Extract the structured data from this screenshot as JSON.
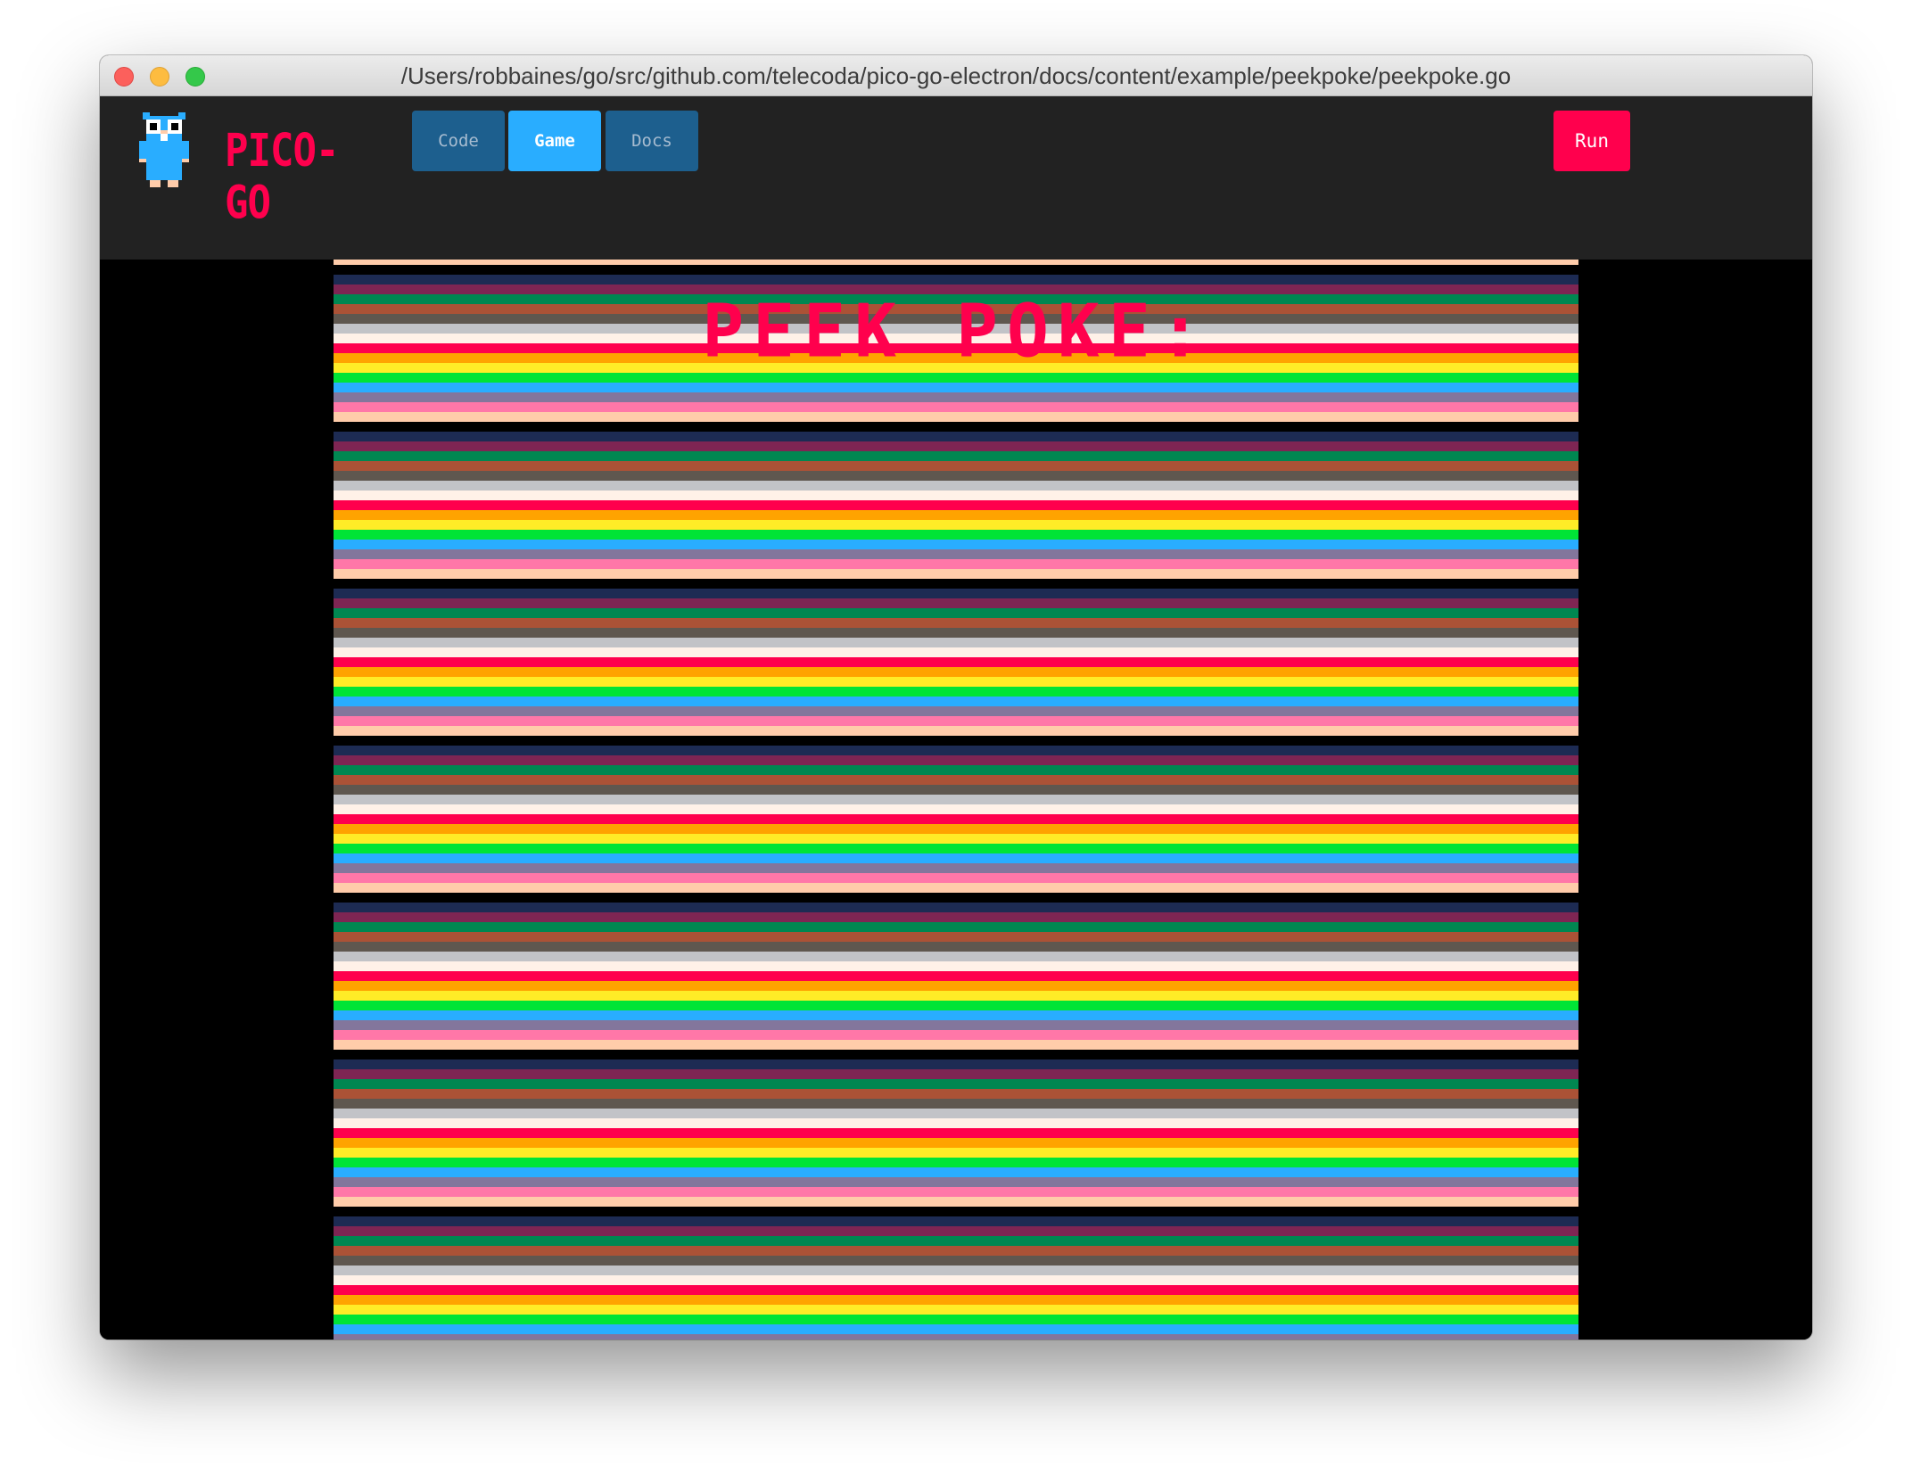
{
  "window": {
    "title": "/Users/robbaines/go/src/github.com/telecoda/pico-go-electron/docs/content/example/peekpoke/peekpoke.go"
  },
  "app": {
    "logo_text": "PICO-GO"
  },
  "tabs": [
    {
      "label": "Code",
      "active": false
    },
    {
      "label": "Game",
      "active": true
    },
    {
      "label": "Docs",
      "active": false
    }
  ],
  "run_label": "Run",
  "game": {
    "title_text": "PEEK POKE:"
  },
  "colors": {
    "accent": "#ff004d",
    "tab_active": "#29adff",
    "tab_inactive": "#1d5f8e",
    "toolbar_bg": "#222222",
    "palette": [
      "#000000",
      "#1d2b53",
      "#7e2553",
      "#008751",
      "#ab5236",
      "#5f574f",
      "#c2c3c7",
      "#fff1e8",
      "#ff004d",
      "#ffa300",
      "#ffec27",
      "#00e436",
      "#29adff",
      "#83769c",
      "#ff77a8",
      "#ffccaa"
    ]
  },
  "icons": {
    "mascot": "gopher-icon"
  }
}
